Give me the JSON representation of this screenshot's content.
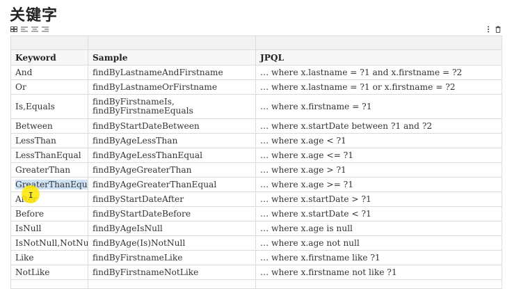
{
  "page": {
    "title": "关键字"
  },
  "toolbar": {
    "left_icons": [
      "table-grid-icon",
      "align-left-icon",
      "align-center-icon",
      "align-right-icon"
    ],
    "right_icons": [
      "more-vertical-icon",
      "trash-icon"
    ]
  },
  "table": {
    "headers": [
      "Keyword",
      "Sample",
      "JPQL"
    ],
    "rows": [
      [
        "And",
        "findByLastnameAndFirstname",
        "… where x.lastname = ?1 and x.firstname = ?2"
      ],
      [
        "Or",
        "findByLastnameOrFirstname",
        "… where x.lastname = ?1 or x.firstname = ?2"
      ],
      [
        "Is,Equals",
        "findByFirstnameIs, findByFirstnameEquals",
        "… where x.firstname = ?1"
      ],
      [
        "Between",
        "findByStartDateBetween",
        "… where x.startDate between ?1 and ?2"
      ],
      [
        "LessThan",
        "findByAgeLessThan",
        "… where x.age < ?1"
      ],
      [
        "LessThanEqual",
        "findByAgeLessThanEqual",
        "… where x.age <= ?1"
      ],
      [
        "GreaterThan",
        "findByAgeGreaterThan",
        "… where x.age > ?1"
      ],
      [
        "GreaterThanEqual",
        "findByAgeGreaterThanEqual",
        "… where x.age >= ?1"
      ],
      [
        "After",
        "findByStartDateAfter",
        "… where x.startDate > ?1"
      ],
      [
        "Before",
        "findByStartDateBefore",
        "… where x.startDate < ?1"
      ],
      [
        "IsNull",
        "findByAgeIsNull",
        "… where x.age is null"
      ],
      [
        "IsNotNull,NotNull",
        "findByAge(Is)NotNull",
        "… where x.age not null"
      ],
      [
        "Like",
        "findByFirstnameLike",
        "… where x.firstname like ?1"
      ],
      [
        "NotLike",
        "findByFirstnameNotLike",
        "… where  x.firstname not like ?1"
      ]
    ]
  },
  "selection": {
    "row_index": 7,
    "column": "Keyword"
  }
}
